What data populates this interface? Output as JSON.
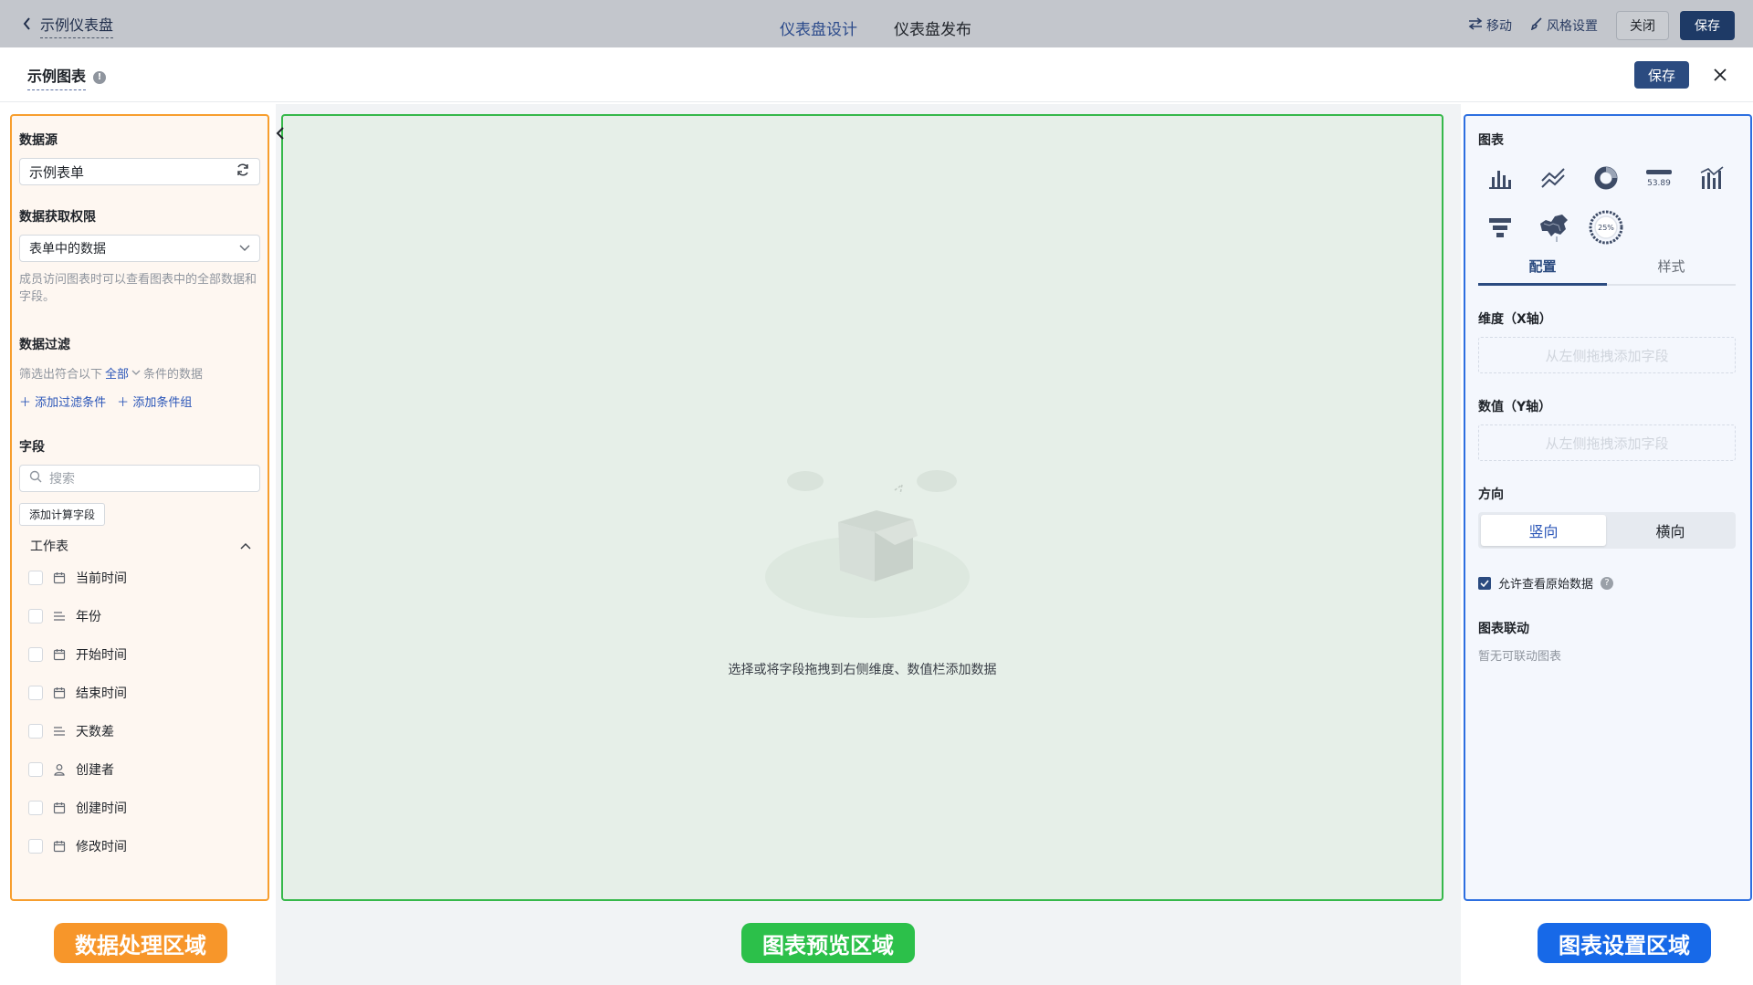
{
  "topbar": {
    "back_label": "示例仪表盘",
    "tabs": [
      {
        "label": "仪表盘设计"
      },
      {
        "label": "仪表盘发布"
      }
    ],
    "move_label": "移动",
    "style_settings_label": "风格设置",
    "close_label": "关闭",
    "save_label": "保存"
  },
  "modal": {
    "chart_title": "示例图表",
    "info_glyph": "!",
    "save_label": "保存"
  },
  "left": {
    "datasource_title": "数据源",
    "datasource_value": "示例表单",
    "permission_title": "数据获取权限",
    "permission_value": "表单中的数据",
    "permission_hint": "成员访问图表时可以查看图表中的全部数据和字段。",
    "filter_title": "数据过滤",
    "filter_prefix": "筛选出符合以下",
    "filter_all": "全部",
    "filter_suffix": "条件的数据",
    "add_filter": "添加过滤条件",
    "add_group": "添加条件组",
    "fields_title": "字段",
    "search_placeholder": "搜索",
    "calc_field_button": "添加计算字段",
    "sheet_label": "工作表",
    "fields": [
      {
        "name": "当前时间",
        "icon": "calendar-icon"
      },
      {
        "name": "年份",
        "icon": "text-lines-icon"
      },
      {
        "name": "开始时间",
        "icon": "calendar-icon"
      },
      {
        "name": "结束时间",
        "icon": "calendar-icon"
      },
      {
        "name": "天数差",
        "icon": "text-lines-icon"
      },
      {
        "name": "创建者",
        "icon": "user-icon"
      },
      {
        "name": "创建时间",
        "icon": "calendar-icon"
      },
      {
        "name": "修改时间",
        "icon": "calendar-icon"
      }
    ]
  },
  "preview": {
    "empty_text": "选择或将字段拖拽到右侧维度、数值栏添加数据"
  },
  "right": {
    "chart_section_title": "图表",
    "chart_types": [
      {
        "icon": "bar-chart-icon"
      },
      {
        "icon": "line-chart-icon"
      },
      {
        "icon": "donut-chart-icon"
      },
      {
        "icon": "indicator-card-icon",
        "label": "53.89"
      },
      {
        "icon": "bar-line-combo-icon"
      },
      {
        "icon": "funnel-chart-icon"
      },
      {
        "icon": "china-map-icon"
      },
      {
        "icon": "gauge-ring-icon",
        "label": "25%"
      }
    ],
    "tabs": [
      {
        "label": "配置"
      },
      {
        "label": "样式"
      }
    ],
    "dimension_title": "维度（X轴）",
    "dimension_placeholder": "从左侧拖拽添加字段",
    "value_title": "数值（Y轴）",
    "value_placeholder": "从左侧拖拽添加字段",
    "direction_title": "方向",
    "direction_options": [
      {
        "label": "竖向"
      },
      {
        "label": "横向"
      }
    ],
    "allow_raw_label": "允许查看原始数据",
    "linkage_title": "图表联动",
    "linkage_empty": "暂无可联动图表"
  },
  "labels": {
    "data_area": "数据处理区域",
    "preview_area": "图表预览区域",
    "settings_area": "图表设置区域"
  },
  "colors": {
    "data_area": "#f7962a",
    "preview_area": "#2cc04a",
    "settings_area": "#1769e8",
    "brand": "#2b4b80"
  }
}
